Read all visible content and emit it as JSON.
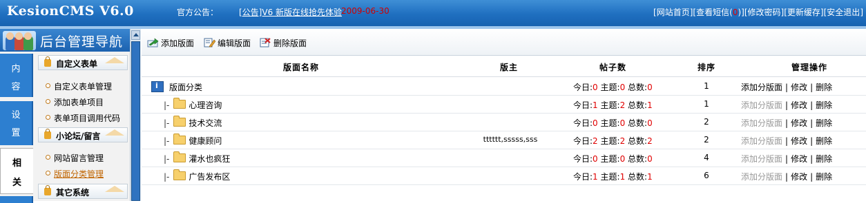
{
  "header": {
    "brand": "KesionCMS V6.0",
    "notice_label": "官方公告：",
    "notice_text": "[公告]V6 新版在线抢先体验",
    "notice_date": "2009-06-30",
    "links": [
      {
        "pre": "[",
        "label": "网站首页",
        "post": "]"
      },
      {
        "pre": "[",
        "label": "查看短信",
        "count": "0",
        "post": "]"
      },
      {
        "pre": "[",
        "label": "修改密码",
        "post": "]"
      },
      {
        "pre": "[",
        "label": "更新缓存",
        "post": "]"
      },
      {
        "pre": "[",
        "label": "安全退出",
        "post": "]"
      }
    ]
  },
  "sidebar": {
    "title": "后台管理导航",
    "tabs": [
      {
        "chars": [
          "内",
          "容"
        ],
        "active": false
      },
      {
        "chars": [
          "设",
          "置"
        ],
        "active": false
      },
      {
        "chars": [
          "相",
          "关"
        ],
        "active": true
      }
    ],
    "sections": [
      {
        "title": "自定义表单",
        "items": [
          "自定义表单管理",
          "添加表单项目",
          "表单项目调用代码"
        ]
      },
      {
        "title": "小论坛/留言",
        "items": [
          "网站留言管理",
          "版面分类管理"
        ]
      },
      {
        "title": "其它系统",
        "items": []
      }
    ],
    "current_item": "版面分类管理"
  },
  "toolbar": {
    "add": "添加版面",
    "edit": "编辑版面",
    "delete": "删除版面"
  },
  "table": {
    "columns": {
      "name": "版面名称",
      "moderator": "版主",
      "posts": "帖子数",
      "order": "排序",
      "actions": "管理操作"
    },
    "labels": {
      "today": "今日:",
      "topics": "主题:",
      "total": "总数:",
      "add_sub": "添加分版面",
      "edit": "修改",
      "delete": "删除",
      "sep": "|",
      "branch": "|-"
    },
    "rows": [
      {
        "name": "版面分类",
        "is_category": true,
        "moderator": "",
        "today": "0",
        "topics": "0",
        "total": "0",
        "order": "1",
        "add_enabled": true
      },
      {
        "name": "心理咨询",
        "is_category": false,
        "moderator": "",
        "today": "1",
        "topics": "2",
        "total": "1",
        "order": "1",
        "add_enabled": false
      },
      {
        "name": "技术交流",
        "is_category": false,
        "moderator": "",
        "today": "0",
        "topics": "0",
        "total": "0",
        "order": "2",
        "add_enabled": false
      },
      {
        "name": "健康顾问",
        "is_category": false,
        "moderator": "tttttt,sssss,sss",
        "today": "2",
        "topics": "2",
        "total": "2",
        "order": "2",
        "add_enabled": false
      },
      {
        "name": "灌水也疯狂",
        "is_category": false,
        "moderator": "",
        "today": "0",
        "topics": "0",
        "total": "0",
        "order": "4",
        "add_enabled": false
      },
      {
        "name": "广告发布区",
        "is_category": false,
        "moderator": "",
        "today": "1",
        "topics": "1",
        "total": "1",
        "order": "6",
        "add_enabled": false
      }
    ]
  },
  "colors": {
    "header_blue": "#1f6fc0",
    "count_red": "#e00000",
    "date_red": "#d00000",
    "disabled_gray": "#999999",
    "current_orange": "#c06400"
  }
}
